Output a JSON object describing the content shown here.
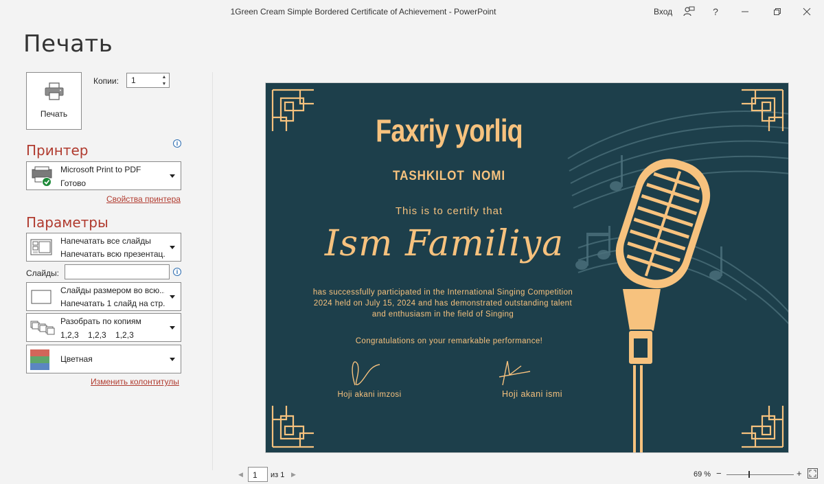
{
  "window": {
    "title": "1Green Cream Simple Bordered Certificate of Achievement  -  PowerPoint",
    "sign_in": "Вход",
    "help_glyph": "?",
    "icons": [
      "user-feedback-icon",
      "help-icon",
      "minimize-icon",
      "restore-icon",
      "close-icon"
    ]
  },
  "print": {
    "page_title": "Печать",
    "print_button": "Печать",
    "copies_label": "Копии:",
    "copies_value": "1"
  },
  "printer": {
    "heading": "Принтер",
    "name": "Microsoft Print to PDF",
    "status": "Готово",
    "properties_link": "Свойства принтера"
  },
  "settings": {
    "heading": "Параметры",
    "range": {
      "line1": "Напечатать все слайды",
      "line2": "Напечатать всю презентац..."
    },
    "slides_label": "Слайды:",
    "slides_value": "",
    "layout": {
      "line1": "Слайды размером во всю...",
      "line2": "Напечатать 1 слайд на стр..."
    },
    "collate": {
      "line1": "Разобрать по копиям",
      "line2": "1,2,3    1,2,3    1,2,3"
    },
    "color": {
      "line1": "Цветная"
    },
    "header_footer_link": "Изменить колонтитулы"
  },
  "certificate": {
    "title": "Faxriy yorliq",
    "organization": "TASHKILOT  NOMI",
    "certify": "This is to certify that",
    "recipient": "Ism Familiya",
    "body": "has successfully participated in the International Singing Competition 2024 held on July 15, 2024 and has demonstrated outstanding talent and enthusiasm in the field of Singing",
    "congrats": "Congratulations on your remarkable performance!",
    "signature1": "Hoji akani imzosi",
    "signature2": "Hoji akani ismi",
    "colors": {
      "background": "#1d3f4b",
      "accent": "#f7c27e"
    }
  },
  "status": {
    "page_value": "1",
    "page_of": "из 1",
    "zoom": "69 %",
    "zoom_minus": "−",
    "zoom_plus": "+"
  }
}
